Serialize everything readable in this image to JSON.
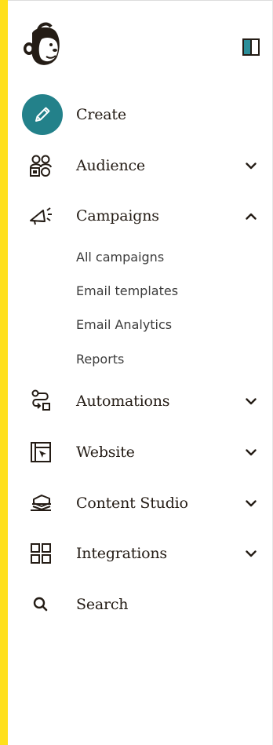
{
  "colors": {
    "accent_bar": "#ffe01b",
    "create_button": "#23818a",
    "text": "#241c15",
    "sub_text": "#3b3b3b",
    "collapse_fill": "#2b8e99"
  },
  "logo": {
    "icon": "mailchimp-freddie-logo"
  },
  "collapse_button": {
    "icon": "sidebar-toggle-icon"
  },
  "nav": {
    "create": {
      "label": "Create",
      "icon": "pencil-icon"
    },
    "audience": {
      "label": "Audience",
      "icon": "audience-icon",
      "chevron": "chevron-down-icon"
    },
    "campaigns": {
      "label": "Campaigns",
      "icon": "megaphone-icon",
      "chevron": "chevron-up-icon",
      "expanded": true,
      "subitems": [
        {
          "label": "All campaigns"
        },
        {
          "label": "Email templates"
        },
        {
          "label": "Email Analytics"
        },
        {
          "label": "Reports"
        }
      ]
    },
    "automations": {
      "label": "Automations",
      "icon": "automations-icon",
      "chevron": "chevron-down-icon"
    },
    "website": {
      "label": "Website",
      "icon": "website-icon",
      "chevron": "chevron-down-icon"
    },
    "content_studio": {
      "label": "Content Studio",
      "icon": "content-studio-icon",
      "chevron": "chevron-down-icon"
    },
    "integrations": {
      "label": "Integrations",
      "icon": "integrations-icon",
      "chevron": "chevron-down-icon"
    },
    "search": {
      "label": "Search",
      "icon": "search-icon"
    }
  }
}
